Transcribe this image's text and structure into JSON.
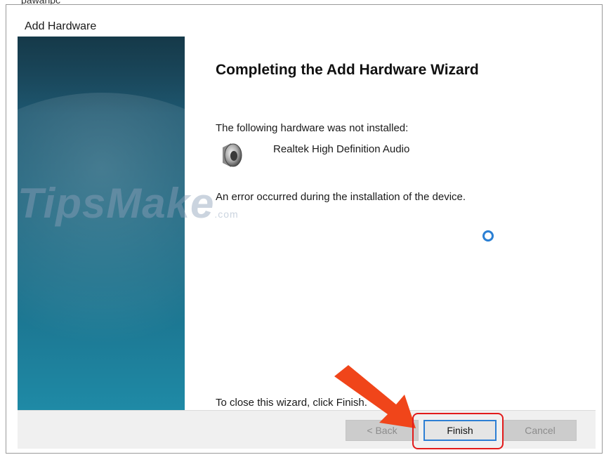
{
  "background_window": {
    "title": "pawanpc"
  },
  "dialog": {
    "title": "Add Hardware",
    "heading": "Completing the Add Hardware Wizard",
    "not_installed_label": "The following hardware was not installed:",
    "device_name": "Realtek High Definition Audio",
    "error_message": "An error occurred during the installation of the device.",
    "close_hint": "To close this wizard, click Finish.",
    "device_icon": "speaker-icon",
    "busy_icon": "loading-ring-icon"
  },
  "buttons": {
    "back": "< Back",
    "finish": "Finish",
    "cancel": "Cancel"
  },
  "watermark": {
    "text": "TipsMake",
    "suffix": ".com"
  },
  "colors": {
    "accent": "#2d7fd4",
    "highlight": "#e21b1b",
    "arrow": "#f0451a",
    "sidebar": "#1c5e78"
  }
}
